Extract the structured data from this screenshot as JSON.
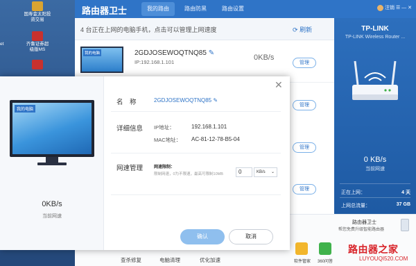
{
  "desktop": {
    "icons": [
      {
        "label": "国寿金太阳投",
        "label2": "资交易"
      },
      {
        "label": "齐鲁证券超",
        "label2": "级版MS"
      },
      {
        "label": "",
        "label2": ""
      }
    ],
    "left_edge": [
      "et",
      ""
    ]
  },
  "app": {
    "title": "路由器卫士",
    "tabs": [
      "我的路由",
      "路由防黑",
      "路由设置"
    ],
    "account": "注销"
  },
  "info_bar": {
    "text": "4 台正在上网的电脑手机，点击可以管理上网速度",
    "refresh": "刷新"
  },
  "devices": [
    {
      "tag": "我的电脑",
      "name": "2GDJOSEWOQTNQ85",
      "ip": "IP:192.168.1.101",
      "speed": "0KB/s",
      "manage": "管理"
    },
    {
      "manage": "管理"
    },
    {
      "manage": "管理"
    },
    {
      "manage": "管理"
    },
    {
      "manage": "管理"
    }
  ],
  "router_panel": {
    "title": "TP-LINK",
    "subtitle": "TP-LINK Wireless Router ...",
    "speed": "0 KB/s",
    "speed_label": "当前网速",
    "online_label": "正在上网：",
    "online_value": "4 天",
    "traffic_label": "上网总流量：",
    "traffic_value": "37 GB"
  },
  "bottom": {
    "tools": [
      "查杀修复",
      "电脑清理",
      "优化加速"
    ],
    "mini_apps": [
      "软件管家",
      "360问答"
    ],
    "promo_title": "路由器卫士",
    "promo_sub": "帮您免费升级智能路由器",
    "watermark": "路由器之家",
    "watermark_url": "LUYOUQI520.COM"
  },
  "modal": {
    "tag": "我的电脑",
    "speed": "0KB/s",
    "speed_label": "当前网速",
    "name_label": "名　称",
    "name_value": "2GDJOSEWOQTNQ85",
    "detail_label": "详细信息",
    "ip_label": "IP地址：",
    "ip_value": "192.168.1.101",
    "mac_label": "MAC地址：",
    "mac_value": "AC-81-12-78-B5-04",
    "speed_mgmt_label": "网速管理",
    "limit_title": "网速限制：",
    "limit_hint": "限制网速，0为不限速，最高可限制10MB",
    "limit_value": "0",
    "limit_unit": "KB/s",
    "ok": "确认",
    "cancel": "取消"
  }
}
